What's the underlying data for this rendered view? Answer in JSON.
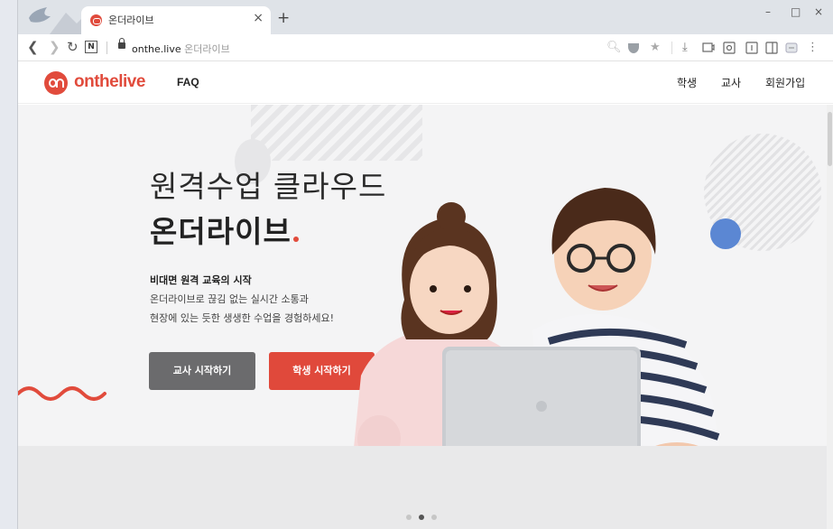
{
  "browser": {
    "tab_title": "온더라이브",
    "tab_close": "×",
    "new_tab": "+",
    "url_domain": "onthe.live",
    "url_site_name": "온더라이브",
    "window_controls": [
      "–",
      "□",
      "×"
    ]
  },
  "site": {
    "logo_text": "onthelive",
    "faq": "FAQ",
    "menu": [
      "학생",
      "교사",
      "회원가입"
    ],
    "brand_color": "#e14b3c"
  },
  "hero": {
    "headline_line1": "원격수업 클라우드",
    "headline_line2": "온더라이브",
    "subtitle": "비대면 원격 교육의 시작",
    "description_line1": "온더라이브로 끊김 없는 실시간 소통과",
    "description_line2": "현장에 있는 듯한 생생한 수업을 경험하세요!",
    "teacher_button": "교사 시작하기",
    "student_button": "학생 시작하기"
  },
  "carousel": {
    "active_index": 1,
    "count": 3
  }
}
